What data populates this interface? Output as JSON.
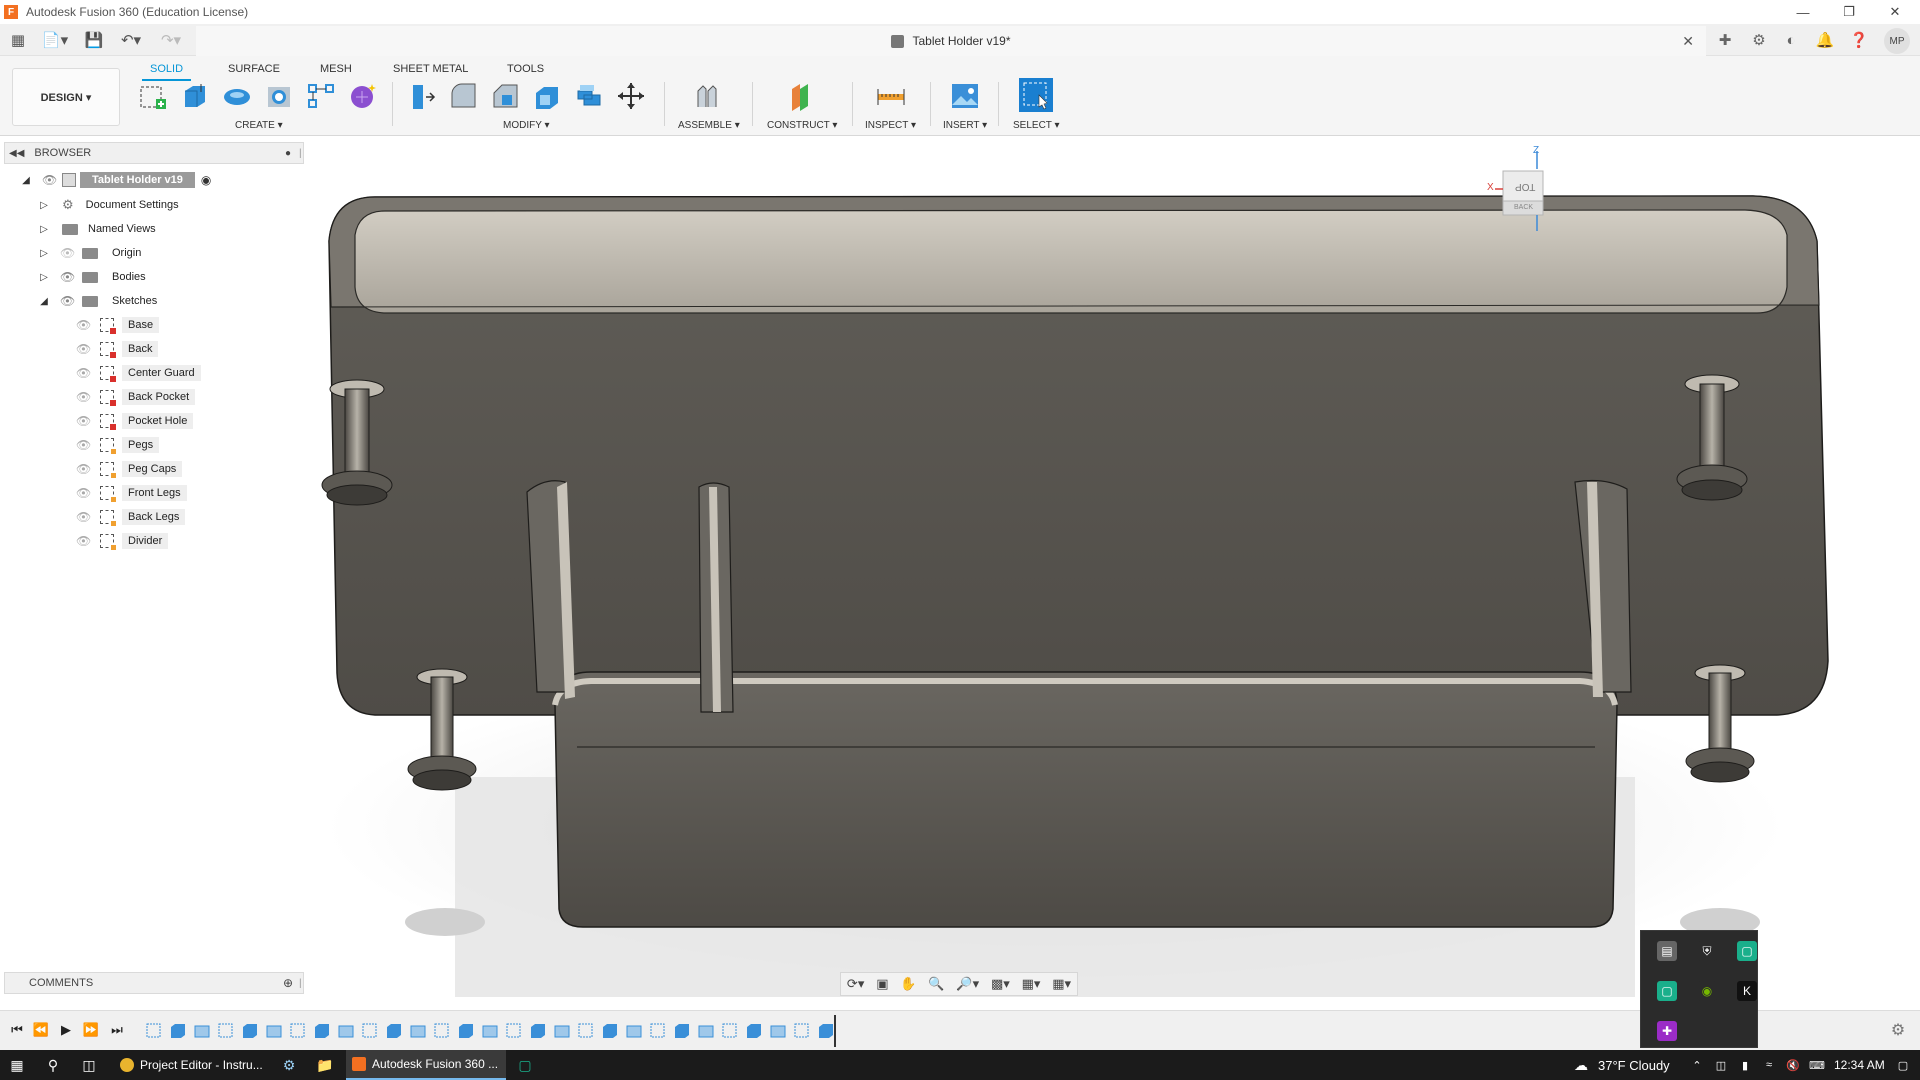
{
  "window": {
    "title": "Autodesk Fusion 360 (Education License)"
  },
  "document_tab": {
    "title": "Tablet Holder v19*"
  },
  "user": {
    "initials": "MP"
  },
  "toolbar": {
    "workspace": "DESIGN ▾",
    "tabs": [
      "SOLID",
      "SURFACE",
      "MESH",
      "SHEET METAL",
      "TOOLS"
    ],
    "groups": {
      "create": "CREATE ▾",
      "modify": "MODIFY ▾",
      "assemble": "ASSEMBLE ▾",
      "construct": "CONSTRUCT ▾",
      "inspect": "INSPECT ▾",
      "insert": "INSERT ▾",
      "select": "SELECT ▾"
    }
  },
  "browser": {
    "header": "BROWSER",
    "root": "Tablet Holder v19",
    "items": [
      {
        "label": "Document Settings"
      },
      {
        "label": "Named Views"
      },
      {
        "label": "Origin"
      },
      {
        "label": "Bodies"
      },
      {
        "label": "Sketches"
      }
    ],
    "sketches": [
      {
        "label": "Base",
        "marker": "red"
      },
      {
        "label": "Back",
        "marker": "red"
      },
      {
        "label": "Center Guard",
        "marker": "red"
      },
      {
        "label": "Back Pocket",
        "marker": "red"
      },
      {
        "label": "Pocket Hole",
        "marker": "red"
      },
      {
        "label": "Pegs",
        "marker": "orange"
      },
      {
        "label": "Peg Caps",
        "marker": "orange"
      },
      {
        "label": "Front Legs",
        "marker": "orange"
      },
      {
        "label": "Back Legs",
        "marker": "orange"
      },
      {
        "label": "Divider",
        "marker": "orange"
      }
    ]
  },
  "comments": {
    "label": "COMMENTS"
  },
  "viewcube": {
    "top": "TOP",
    "back": "BACK",
    "axis_x": "X",
    "axis_z": "Z"
  },
  "taskbar": {
    "apps": [
      {
        "label": "Project Editor - Instru..."
      },
      {
        "label": "Autodesk Fusion 360 ..."
      }
    ],
    "weather": "37°F  Cloudy",
    "time": "12:34 AM"
  },
  "colors": {
    "accent": "#0696d7",
    "model": "#5b5852",
    "model_top": "#b9b4aa"
  }
}
